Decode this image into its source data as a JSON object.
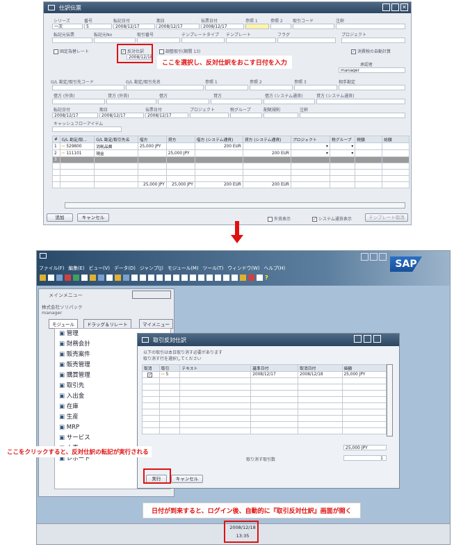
{
  "top_window": {
    "title": "仕訳伝票",
    "header_labels": [
      "シリーズ",
      "番号",
      "転記日付",
      "期日",
      "伝票日付",
      "参照 1",
      "参照 2",
      "取引コード",
      "注釈"
    ],
    "header_values": {
      "series": "一次",
      "number": "5",
      "posting_date": "2008/12/17",
      "due_date": "2008/12/17",
      "doc_date": "2008/12/17"
    },
    "row2_labels": [
      "転記元伝票",
      "転記元No",
      "取引番号",
      "テンプレートタイプ",
      "テンプレート",
      "フラグ",
      "プロジェクト"
    ],
    "fixed_rate": "固定為替レート",
    "reversal": "反対仕訳",
    "reversal_date": "2008/12/18",
    "adjust": "調整取引(期間 13)",
    "auto_tax": "消費税の自動計算",
    "approver_label": "承認者",
    "approver_value": "manager",
    "section2_labels": [
      "G/L 勘定/取引先コード",
      "G/L 勘定/取引先名",
      "参照 1",
      "参照 2",
      "参照 3",
      "相手勘定"
    ],
    "section3_labels": [
      "借方 (外貨)",
      "貸方 (外貨)",
      "借方",
      "貸方",
      "借方 (システム通貨)",
      "貸方 (システム通貨)"
    ],
    "section4_labels": [
      "転記日付",
      "期日",
      "伝票日付",
      "プロジェクト",
      "税グループ",
      "配賦規則",
      "注釈"
    ],
    "section4_values": [
      "2008/12/17",
      "2008/12/17",
      "2008/12/17"
    ],
    "cashflow": "キャッシュフローアイテム",
    "grid_headers": [
      "#",
      "G/L 勘定/取...",
      "G/L 勘定/取引先名",
      "借方",
      "貸方",
      "借方 (システム通貨)",
      "貸方 (システム通貨)",
      "プロジェクト",
      "税グループ",
      "税額",
      "総額"
    ],
    "grid_rows": [
      [
        "1",
        "529800",
        "消耗品費",
        "25,000 JPY",
        "",
        "200 EUR",
        "",
        "",
        "",
        ""
      ],
      [
        "2",
        "111101",
        "現金",
        "",
        "25,000 JPY",
        "",
        "200 EUR",
        "",
        "",
        ""
      ],
      [
        "3",
        "",
        "",
        "",
        "",
        "",
        "",
        "",
        "",
        ""
      ]
    ],
    "totals": [
      "25,000 JPY",
      "25,000 JPY",
      "200 EUR",
      "200 EUR"
    ],
    "add_button": "追加",
    "cancel_button": "キャンセル",
    "foreign_display": "外貨表示",
    "system_display": "システム通貨表示",
    "template_cancel": "テンプレート取消"
  },
  "annotation_top": "ここを選択し、反対仕訳をおこす日付を入力",
  "sap_window": {
    "menu": [
      "ファイル(F)",
      "編集(E)",
      "ビュー(V)",
      "データ(D)",
      "ジャンプ(J)",
      "モジュール(M)",
      "ツール(T)",
      "ウィンドウ(W)",
      "ヘルプ(H)"
    ],
    "logo": "SAP",
    "main_menu_title": "メインメニュー",
    "company": "株式会社ソリパック",
    "user": "manager",
    "tabs": [
      "モジュール",
      "ドラッグ＆リレート",
      "マイメニュー"
    ],
    "modules": [
      "管理",
      "財務会計",
      "販売案件",
      "販売管理",
      "購買管理",
      "取引先",
      "入出金",
      "在庫",
      "生産",
      "MRP",
      "サービス",
      "人事",
      "レポート"
    ],
    "dialog": {
      "title": "取引反対仕訳",
      "msg1": "以下の取引は本日取り消す必要があります",
      "msg2": "取り消す行を選択してください",
      "headers": [
        "取消",
        "取引",
        "テキスト",
        "基準日付",
        "取消日付",
        "価額"
      ],
      "row": [
        "",
        "5",
        "",
        "2008/12/17",
        "2008/12/18",
        "25,000 JPY"
      ],
      "total": "25,000 JPY",
      "count_label": "取り消す取引数",
      "count": "1",
      "execute": "実行",
      "cancel": "キャンセル"
    },
    "status_date": "2008/12/18",
    "status_time": "13:35"
  },
  "annotation_left": "ここをクリックすると、反対仕訳の転記が実行される",
  "annotation_bottom": "日付が到来すると、ログイン後、自動的に『取引反対仕訳』画面が開く"
}
